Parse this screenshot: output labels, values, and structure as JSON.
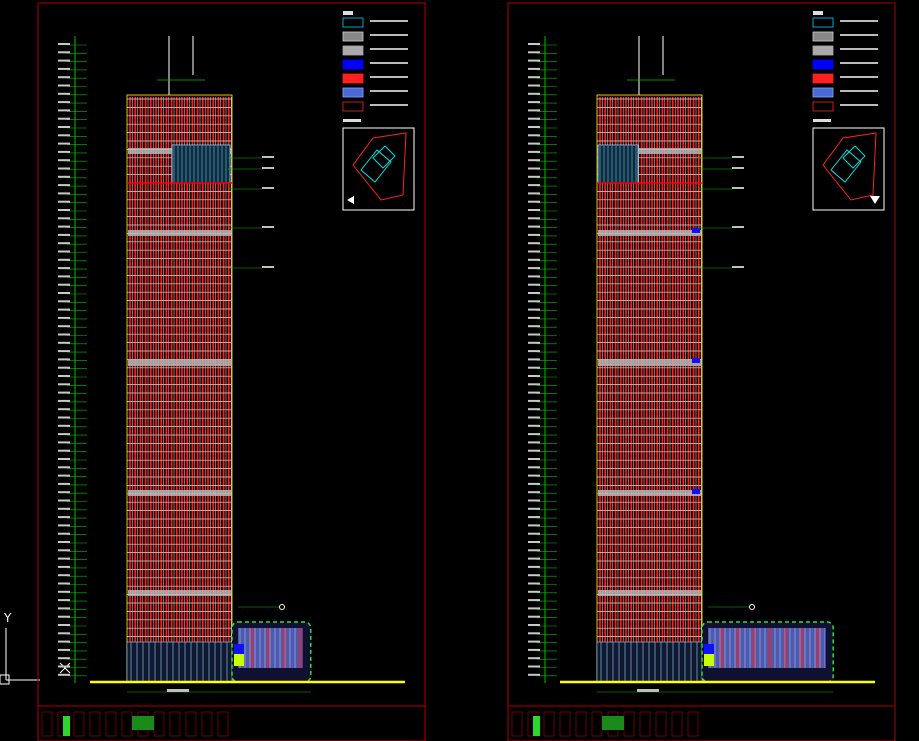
{
  "canvas": {
    "background": "#000000"
  },
  "colors": {
    "frame": "#b00000",
    "facade": "#ff1a1a",
    "mullion": "#d9d9d9",
    "level_line": "#00c000",
    "ground": "#ffff00",
    "glass": "#8fd6ff",
    "podium_glass": "#9aa8ff",
    "marker_blue": "#1010ff",
    "podium_outline": "#33dd33",
    "ucs": "#ffffff"
  },
  "legend_swatches": [
    {
      "name": "glass-curtain-wall",
      "fill": "#000000",
      "stroke": "#00d0ff"
    },
    {
      "name": "stone-hatch",
      "fill": "#888888",
      "stroke": "#cccccc"
    },
    {
      "name": "grey-panel",
      "fill": "#aaaaaa",
      "stroke": "#aaaaaa"
    },
    {
      "name": "blue-panel",
      "fill": "#0000ff",
      "stroke": "#0000ff"
    },
    {
      "name": "red-panel",
      "fill": "#ff2020",
      "stroke": "#ff2020"
    },
    {
      "name": "blue-hatch",
      "fill": "#4a6ad8",
      "stroke": "#8aa0ff"
    },
    {
      "name": "red-louver",
      "fill": "#000000",
      "stroke": "#ff2020"
    }
  ],
  "ucs_icon": {
    "axis_label": "Y"
  },
  "sheets": [
    {
      "id": "left",
      "podium_width_ratio": 0.75,
      "compass_arrow": "left"
    },
    {
      "id": "right",
      "podium_width_ratio": 1.25,
      "compass_arrow": "down"
    }
  ]
}
